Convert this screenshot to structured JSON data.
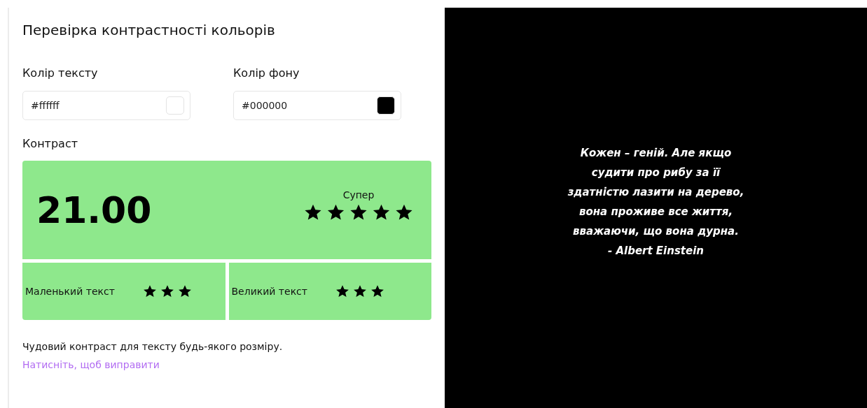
{
  "title": "Перевірка контрастності кольорів",
  "color_fields": [
    {
      "label": "Колір тексту",
      "value": "#ffffff",
      "color": "#ffffff"
    },
    {
      "label": "Колір фону",
      "value": "#000000",
      "color": "#000000"
    }
  ],
  "contrast": {
    "label": "Контраст",
    "ratio": "21.00",
    "rating": "Супер",
    "stars": 5,
    "sub_ratings": [
      {
        "label": "Маленький текст",
        "stars": 3
      },
      {
        "label": "Великий текст",
        "stars": 3
      }
    ]
  },
  "message": "Чудовий контраст для тексту будь-якого розміру.",
  "fix_link": "Натисніть, щоб виправити",
  "preview": {
    "quote": "Кожен – геній. Але якщо\nсудити про рибу за її\nздатністю лазити на дерево,\nвона проживе все життя,\nвважаючи, що вона дурна.",
    "author": "- Albert Einstein"
  }
}
